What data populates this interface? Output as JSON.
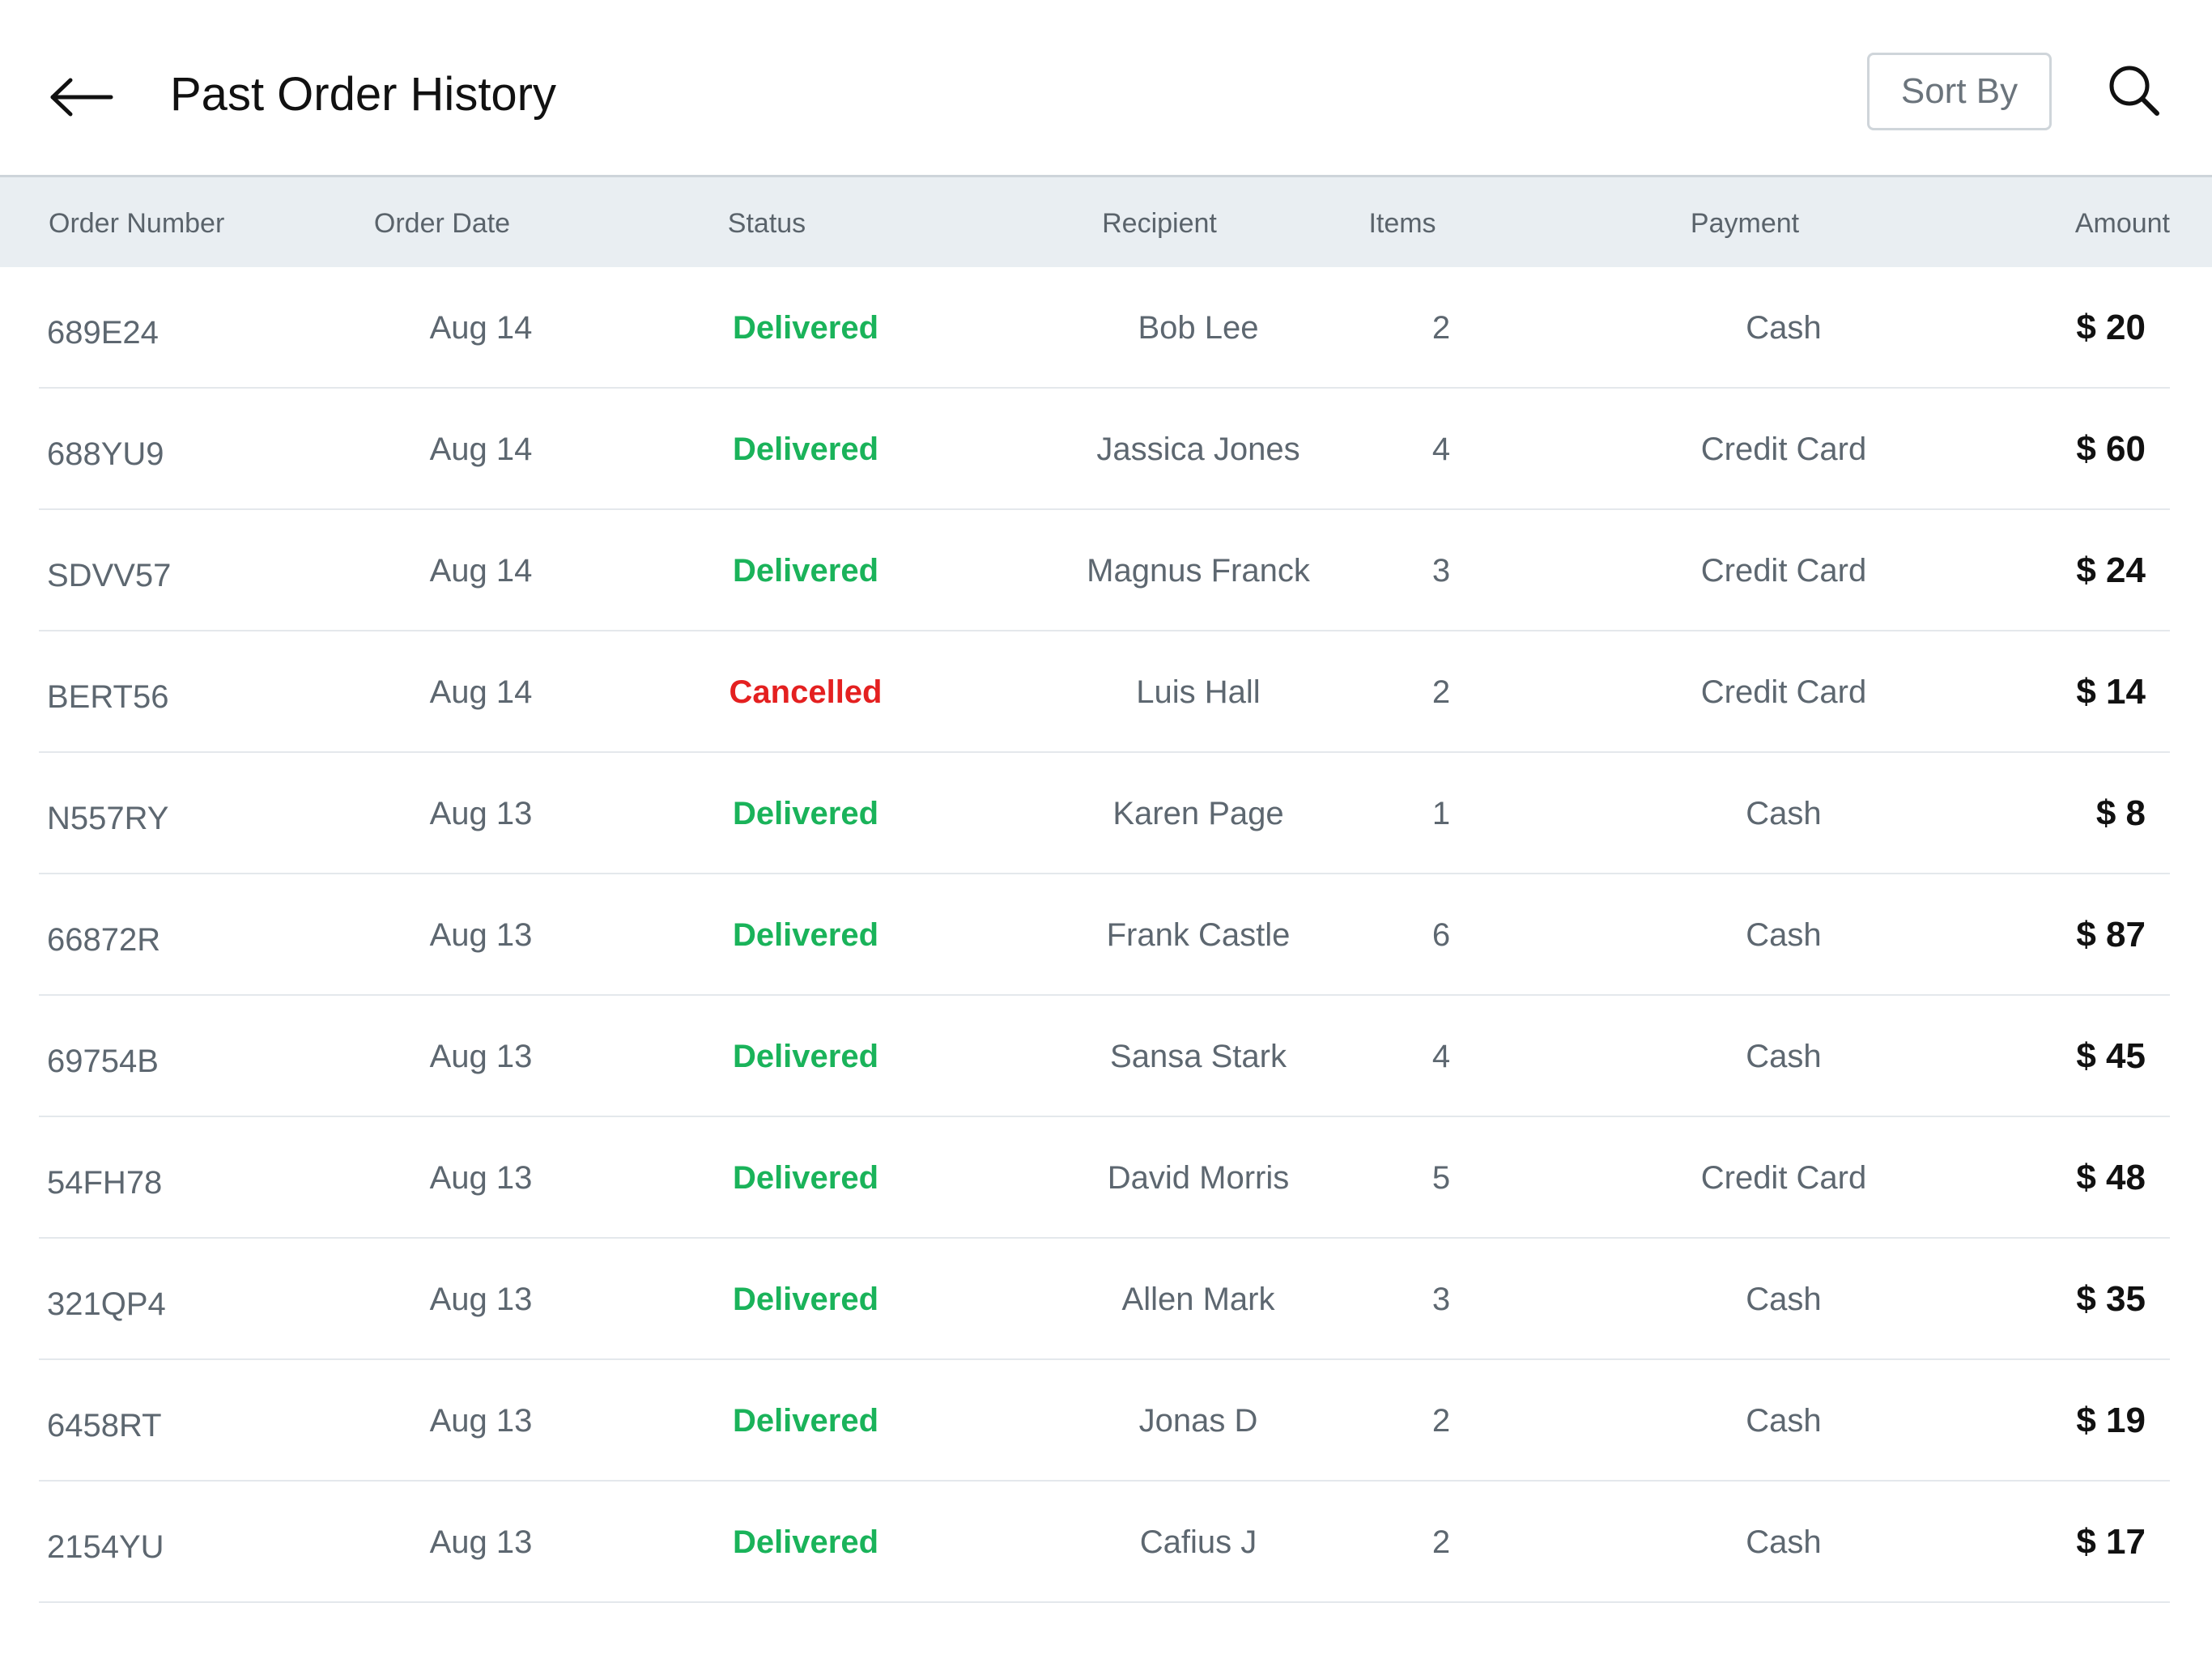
{
  "header": {
    "title": "Past Order History",
    "sort_label": "Sort By",
    "back_icon": "arrow-left-icon",
    "search_icon": "search-icon"
  },
  "columns": [
    "Order Number",
    "Order Date",
    "Status",
    "Recipient",
    "Items",
    "Payment",
    "Amount"
  ],
  "colors": {
    "delivered": "#1ab35a",
    "cancelled": "#e42020",
    "header_bg": "#e9eef2"
  },
  "orders": [
    {
      "number": "689E24",
      "date": "Aug 14",
      "status": "Delivered",
      "recipient": "Bob Lee",
      "items": "2",
      "payment": "Cash",
      "amount": "$ 20"
    },
    {
      "number": "688YU9",
      "date": "Aug 14",
      "status": "Delivered",
      "recipient": "Jassica Jones",
      "items": "4",
      "payment": "Credit Card",
      "amount": "$ 60"
    },
    {
      "number": "SDVV57",
      "date": "Aug 14",
      "status": "Delivered",
      "recipient": "Magnus Franck",
      "items": "3",
      "payment": "Credit Card",
      "amount": "$ 24"
    },
    {
      "number": "BERT56",
      "date": "Aug 14",
      "status": "Cancelled",
      "recipient": "Luis Hall",
      "items": "2",
      "payment": "Credit Card",
      "amount": "$ 14"
    },
    {
      "number": "N557RY",
      "date": "Aug 13",
      "status": "Delivered",
      "recipient": "Karen Page",
      "items": "1",
      "payment": "Cash",
      "amount": "$ 8"
    },
    {
      "number": "66872R",
      "date": "Aug 13",
      "status": "Delivered",
      "recipient": "Frank Castle",
      "items": "6",
      "payment": "Cash",
      "amount": "$ 87"
    },
    {
      "number": "69754B",
      "date": "Aug 13",
      "status": "Delivered",
      "recipient": "Sansa Stark",
      "items": "4",
      "payment": "Cash",
      "amount": "$ 45"
    },
    {
      "number": "54FH78",
      "date": "Aug 13",
      "status": "Delivered",
      "recipient": "David Morris",
      "items": "5",
      "payment": "Credit Card",
      "amount": "$ 48"
    },
    {
      "number": "321QP4",
      "date": "Aug 13",
      "status": "Delivered",
      "recipient": "Allen Mark",
      "items": "3",
      "payment": "Cash",
      "amount": "$ 35"
    },
    {
      "number": "6458RT",
      "date": "Aug 13",
      "status": "Delivered",
      "recipient": "Jonas D",
      "items": "2",
      "payment": "Cash",
      "amount": "$ 19"
    },
    {
      "number": "2154YU",
      "date": "Aug 13",
      "status": "Delivered",
      "recipient": "Cafius J",
      "items": "2",
      "payment": "Cash",
      "amount": "$ 17"
    }
  ]
}
